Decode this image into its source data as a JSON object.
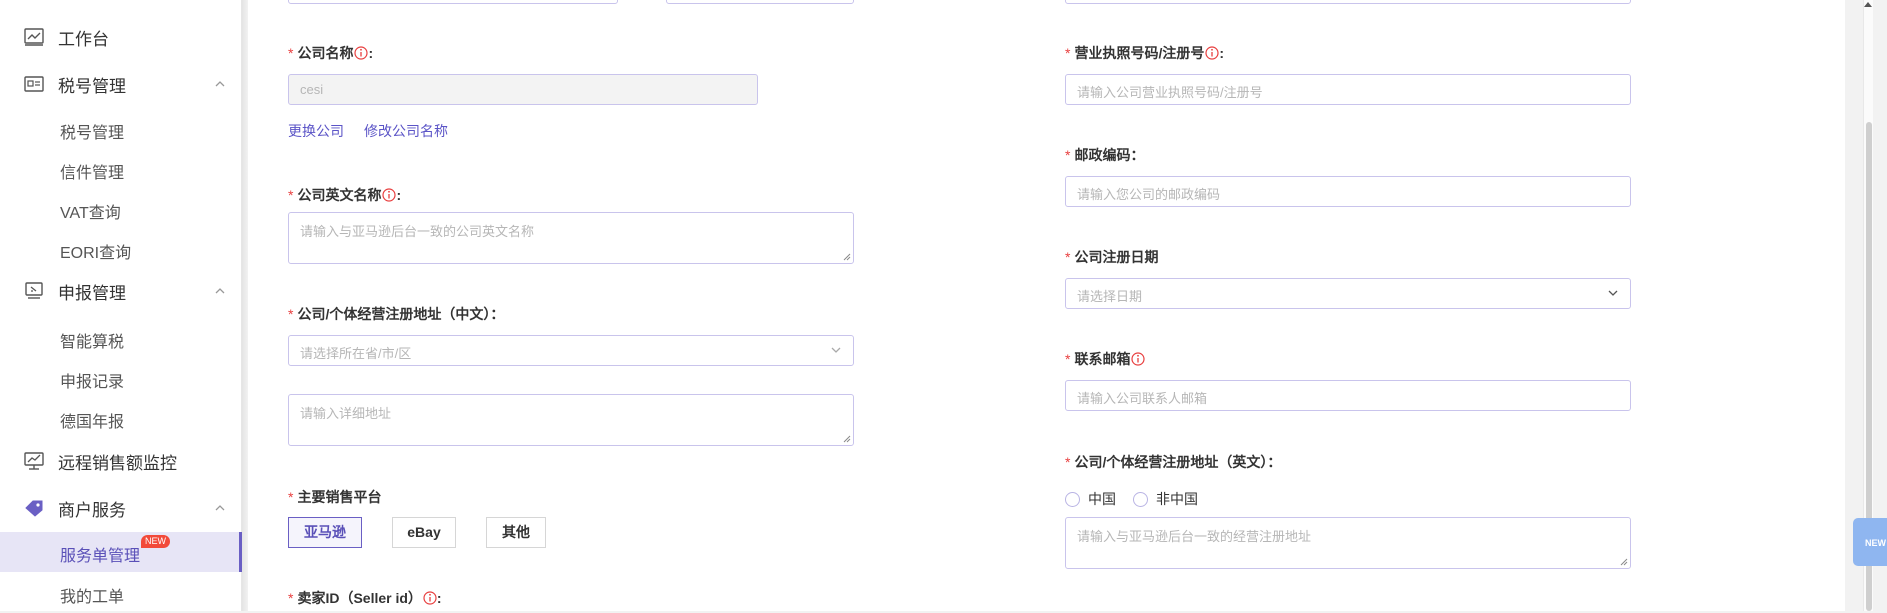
{
  "sidebar": {
    "groups": {
      "workbench": "工作台",
      "tax": "税号管理",
      "declare": "申报管理",
      "remote": "远程销售额监控",
      "merchant": "商户服务"
    },
    "items": {
      "tax_mgmt": "税号管理",
      "letters": "信件管理",
      "vat": "VAT查询",
      "eori": "EORI查询",
      "smart_tax": "智能算税",
      "records": "申报记录",
      "germany": "德国年报",
      "service_orders": "服务单管理",
      "my_tickets": "我的工单"
    },
    "new_badge": "NEW"
  },
  "form": {
    "company_name": {
      "label": "公司名称",
      "colon": ":",
      "value": "cesi",
      "links": {
        "change": "更换公司",
        "rename": "修改公司名称"
      }
    },
    "company_en_name": {
      "label": "公司英文名称",
      "colon": ":",
      "placeholder": "请输入与亚马逊后台一致的公司英文名称"
    },
    "address_cn": {
      "label": "公司/个体经营注册地址（中文）：",
      "select_placeholder": "请选择所在省/市/区",
      "detail_placeholder": "请输入详细地址"
    },
    "platform": {
      "label": "主要销售平台",
      "options": [
        "亚马逊",
        "eBay",
        "其他"
      ],
      "selected": "亚马逊"
    },
    "seller_id": {
      "label": "卖家ID（Seller id）",
      "colon": ":"
    },
    "license_no": {
      "label": "营业执照号码/注册号",
      "colon": ":",
      "placeholder": "请输入公司营业执照号码/注册号"
    },
    "postal_code": {
      "label": "邮政编码：",
      "placeholder": "请输入您公司的邮政编码"
    },
    "reg_date": {
      "label": "公司注册日期",
      "placeholder": "请选择日期"
    },
    "email": {
      "label": "联系邮箱",
      "placeholder": "请输入公司联系人邮箱"
    },
    "address_en": {
      "label": "公司/个体经营注册地址（英文）：",
      "radio_china": "中国",
      "radio_non_china": "非中国",
      "placeholder": "请输入与亚马逊后台一致的经营注册地址"
    },
    "required_mark": "*"
  },
  "float_button": {
    "label": "NEW"
  },
  "colors": {
    "accent": "#6a5fc4",
    "required": "#e83f3f",
    "link": "#5b54c7"
  }
}
